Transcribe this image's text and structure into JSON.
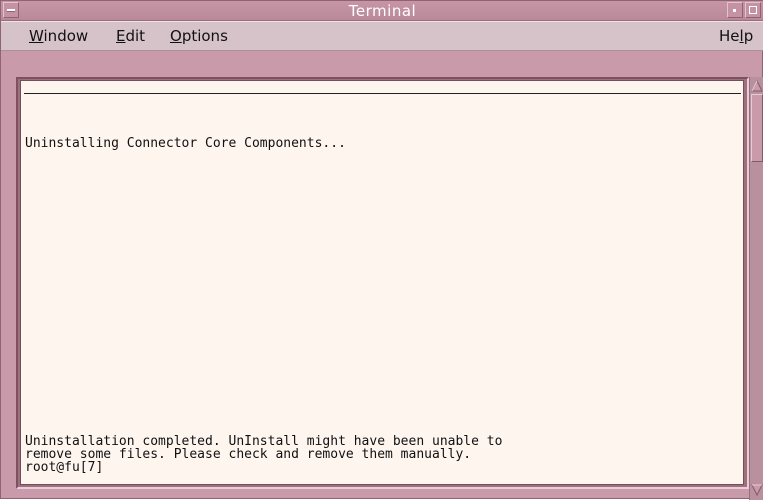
{
  "window": {
    "title": "Terminal"
  },
  "menubar": {
    "items": [
      {
        "label": "Window",
        "mnemonic": "W",
        "rest": "indow"
      },
      {
        "label": "Edit",
        "mnemonic": "E",
        "rest": "dit"
      },
      {
        "label": "Options",
        "mnemonic": "O",
        "rest": "ptions"
      }
    ],
    "help": {
      "label": "Help",
      "pre": "He",
      "mnemonic": "l",
      "post": "p"
    }
  },
  "terminal": {
    "lines": [
      "Uninstalling Connector Core Components...",
      "Uninstallation completed. UnInstall might have been unable to",
      "remove some files. Please check and remove them manually.",
      "root@fu[7]"
    ]
  },
  "colors": {
    "titlebar": "#c795a6",
    "menubar": "#d6c3c9",
    "terminal_background": "#fef5ef",
    "frame": "#c99aa9"
  },
  "icons": {
    "window_menu": "window-menu-icon",
    "minimize": "minimize-icon",
    "maximize": "maximize-icon",
    "scroll_up": "scroll-up-arrow-icon",
    "scroll_down": "scroll-down-arrow-icon"
  }
}
